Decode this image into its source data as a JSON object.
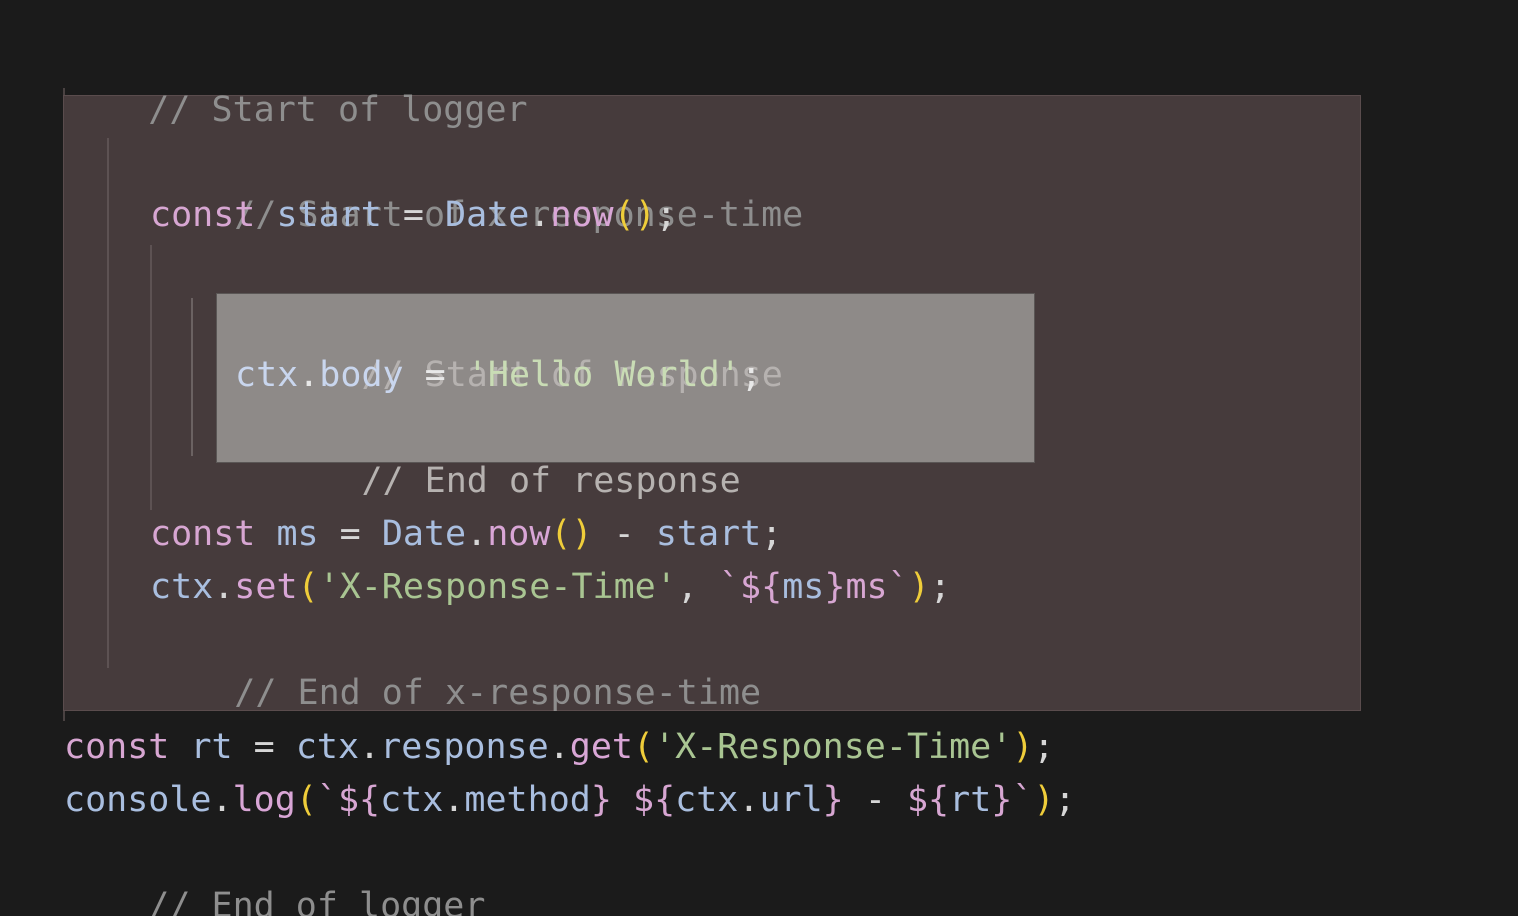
{
  "editor": {
    "theme": {
      "background": "#1b1b1b",
      "outer_block_bg": "#463b3c",
      "inner_block_bg": "#8e8a88",
      "comment": "#8e8e8e",
      "keyword": "#d7a6d2",
      "variable": "#a9bedf",
      "string": "#a9c592",
      "paren": "#efcd3a"
    },
    "lines": {
      "l1": {
        "comment": "// Start of logger"
      },
      "l2": {
        "comment": "// Start of x-response-time"
      },
      "l3": {
        "kw": "const",
        "name": "start",
        "op": "=",
        "obj": "Date",
        "dot": ".",
        "fn": "now",
        "parens": "()",
        "semi": ";"
      },
      "l4": {
        "comment": "// Start of response"
      },
      "l5": {
        "obj": "ctx",
        "dot": ".",
        "prop": "body",
        "op": "=",
        "str": "'Hello World'",
        "semi": ";"
      },
      "l6": {
        "comment": "// End of response"
      },
      "l7": {
        "kw": "const",
        "name": "ms",
        "op": "=",
        "obj": "Date",
        "dot": ".",
        "fn": "now",
        "parens": "()",
        "minus": "-",
        "start": "start",
        "semi": ";"
      },
      "l8": {
        "obj": "ctx",
        "dot": ".",
        "fn": "set",
        "open": "(",
        "str": "'X-Response-Time'",
        "comma": ",",
        "tpl_open": "`${",
        "tpl_var": "ms",
        "tpl_close": "}",
        "tpl_text": "ms`",
        "close": ")",
        "semi": ";"
      },
      "l9": {
        "comment": "// End of x-response-time"
      },
      "l10": {
        "kw": "const",
        "name": "rt",
        "op": "=",
        "obj": "ctx",
        "dot": ".",
        "prop": "response",
        "dot2": ".",
        "fn": "get",
        "open": "(",
        "str": "'X-Response-Time'",
        "close": ")",
        "semi": ";"
      },
      "l11": {
        "obj": "console",
        "dot": ".",
        "fn": "log",
        "open": "(",
        "tpl1_open": "`${",
        "tpl1_obj": "ctx",
        "tpl1_dot": ".",
        "tpl1_prop": "method",
        "tpl1_close": "}",
        "tpl2_open": "${",
        "tpl2_obj": "ctx",
        "tpl2_dot": ".",
        "tpl2_prop": "url",
        "tpl2_close": "}",
        "minus": "-",
        "tpl3_open": "${",
        "tpl3_var": "rt",
        "tpl3_close": "}`",
        "close": ")",
        "semi": ";"
      },
      "l12": {
        "comment": "// End of logger"
      }
    }
  }
}
